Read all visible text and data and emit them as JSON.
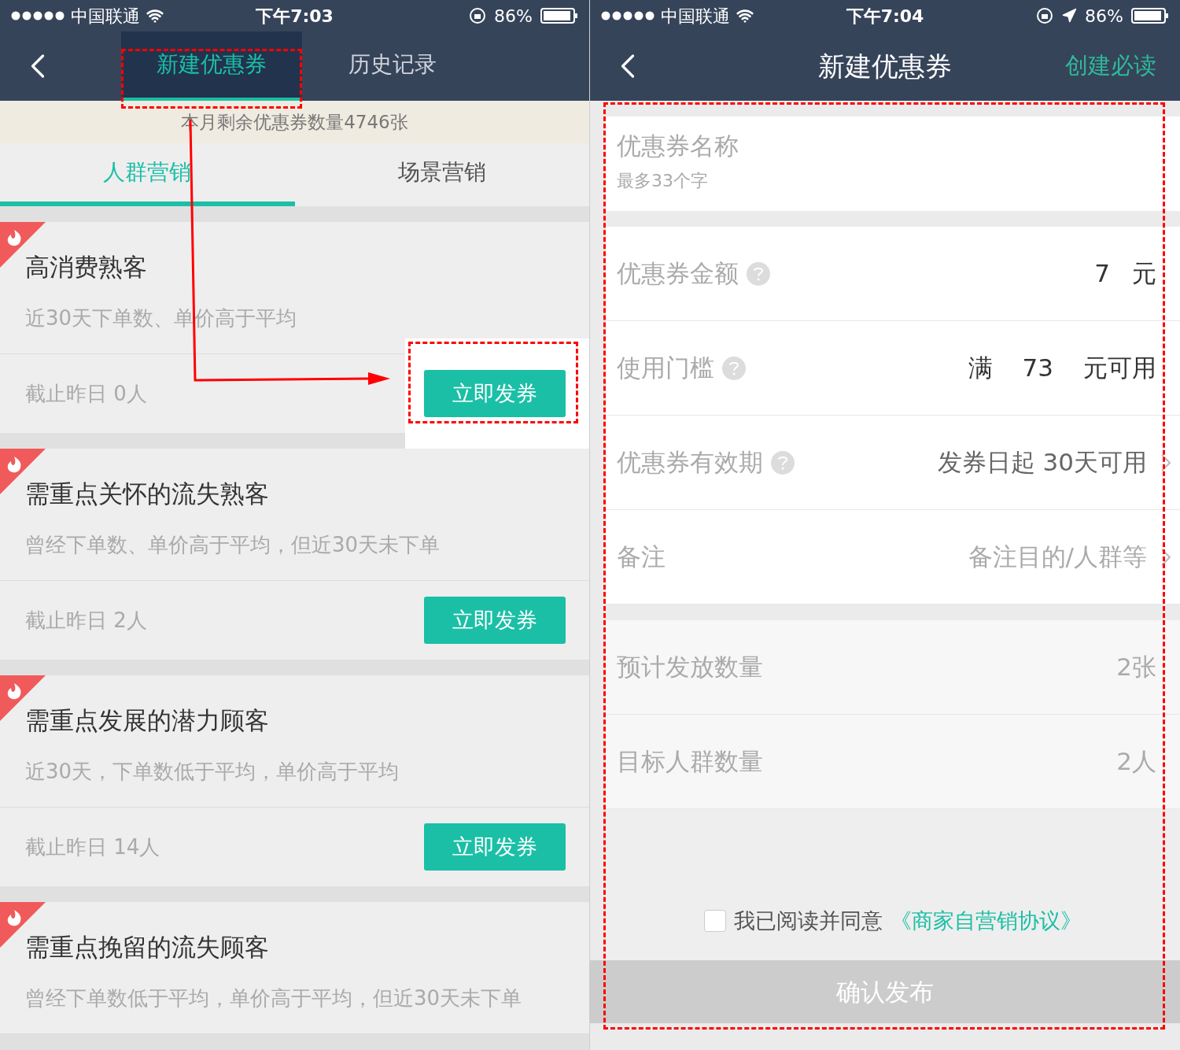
{
  "left_screen": {
    "status_bar": {
      "carrier": "中国联通",
      "time": "下午7:03",
      "battery": "86%"
    },
    "nav_tabs": [
      {
        "label": "新建优惠券",
        "selected": true,
        "highlighted": true
      },
      {
        "label": "历史记录",
        "selected": false,
        "highlighted": false
      }
    ],
    "banner": "本月剩余优惠券数量4746张",
    "segments": [
      {
        "label": "人群营销",
        "selected": true
      },
      {
        "label": "场景营销",
        "selected": false
      }
    ],
    "groups": [
      {
        "title": "高消费熟客",
        "description": "近30天下单数、单价高于平均",
        "count": "截止昨日 0人",
        "button": "立即发券",
        "highlighted": true
      },
      {
        "title": "需重点关怀的流失熟客",
        "description": "曾经下单数、单价高于平均，但近30天未下单",
        "count": "截止昨日 2人",
        "button": "立即发券",
        "highlighted": false
      },
      {
        "title": "需重点发展的潜力顾客",
        "description": "近30天，下单数低于平均，单价高于平均",
        "count": "截止昨日 14人",
        "button": "立即发券",
        "highlighted": false
      },
      {
        "title": "需重点挽留的流失顾客",
        "description": "曾经下单数低于平均，单价高于平均，但近30天未下单"
      }
    ]
  },
  "right_screen": {
    "status_bar": {
      "carrier": "中国联通",
      "time": "下午7:04",
      "battery": "86%"
    },
    "title": "新建优惠券",
    "action": "创建必读",
    "name_field": {
      "label": "优惠券名称",
      "placeholder": "最多33个字"
    },
    "rows": [
      {
        "kind": "amount",
        "label": "优惠券金额",
        "help": true,
        "value": "7",
        "unit": "元"
      },
      {
        "kind": "threshold",
        "label": "使用门槛",
        "help": true,
        "prefix": "满",
        "value": "73",
        "suffix": "元可用"
      },
      {
        "kind": "select",
        "label": "优惠券有效期",
        "help": true,
        "value": "发券日起 30天可用"
      },
      {
        "kind": "select",
        "label": "备注",
        "help": false,
        "placeholder": "备注目的/人群等"
      }
    ],
    "info_rows": [
      {
        "label": "预计发放数量",
        "value": "2张"
      },
      {
        "label": "目标人群数量",
        "value": "2人"
      }
    ],
    "agreement": {
      "checked": false,
      "text": "我已阅读并同意",
      "link": "《商家自营销协议》"
    },
    "submit": {
      "label": "确认发布",
      "disabled": true
    }
  }
}
